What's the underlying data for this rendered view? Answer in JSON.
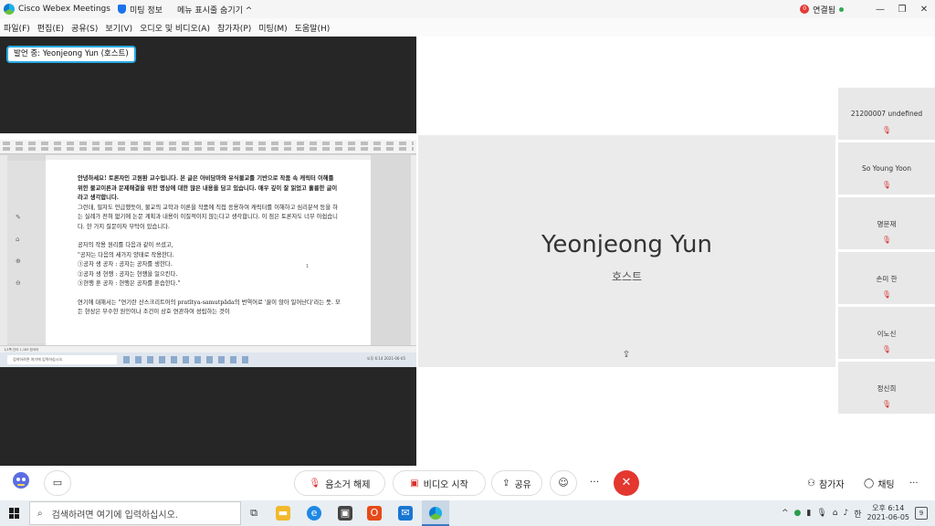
{
  "titlebar": {
    "app_name": "Cisco Webex Meetings",
    "meeting_info": "미팅 정보",
    "menu_toggle": "메뉴 표시줄 숨기기 ^",
    "connection_label": "연결됨",
    "connection_badge": "0",
    "minimize": "—",
    "restore": "❐",
    "close": "✕"
  },
  "menubar": {
    "items": [
      "파일(F)",
      "편집(E)",
      "공유(S)",
      "보기(V)",
      "오디오 및 비디오(A)",
      "참가자(P)",
      "미팅(M)",
      "도움말(H)"
    ]
  },
  "share": {
    "presenter_label": "발언 중: Yeonjeong Yun (호스트)"
  },
  "document": {
    "paragraphs": [
      "안녕하세요! 토론자인 고원환 교수입니다. 본 글은 아비담마와 유식불교를 기반으로 작품 속 캐릭터 이해를 위한 불교이론과 문제해결을 위한 명상에 대한 많은 내용을 담고 있습니다. 매우 깊이 잘 읽었고 훌륭한 글이라고 생각합니다.",
      "그런데, 필자도 언급했듯이, 불교의 교학과 이론을 작품에 직접 응용하여 캐릭터를 이해하고 심리분석 등을 하는 실례가 전혀 없기에 논문 계획과 내용이 이질적이지 않는다고 생각합니다. 이 점은 토론자도 너무 아쉽습니다. 한 가지 질문이자 부탁이 있습니다.",
      "공자의 작용 원리를 다음과 같이 쓰셨고,",
      "\"공자는 다음의 세가지 양태로 작용한다.",
      "①공자 생 공자 : 공자는 공자를 생한다.",
      "②공자 생 현행 : 공자는 현행을 일으킨다.",
      "③현행 훈 공자 : 현행은 공자를 훈습한다.\"",
      "연기에 대해서는 \"연기란 산스크리트어의 pratītya-samutpāda의 번역어로 '꿀이 앉아 일어난다'라는 뜻. 모든 현상은 무수한 원인이나 조건이 상호 연관하여 성립하는 것이"
    ],
    "page_number": "1",
    "status_text": "1/1쪽  단어 1,183  한국어",
    "taskbar_search": "검색하려면 여기에 입력하십시오.",
    "taskbar_clock": "오후 6:14 2021-06-05"
  },
  "speaker": {
    "name": "Yeonjeong Yun",
    "role": "호스트"
  },
  "participants": [
    {
      "name": "21200007 undefined"
    },
    {
      "name": "So Young Yoon"
    },
    {
      "name": "명문재"
    },
    {
      "name": "손미 한"
    },
    {
      "name": "이노신"
    },
    {
      "name": "정신희"
    }
  ],
  "controls": {
    "mute_label": "음소거 해제",
    "video_label": "비디오 시작",
    "share_label": "공유",
    "more": "···",
    "end": "✕",
    "participants_label": "참가자",
    "chat_label": "채팅",
    "right_more": "···"
  },
  "taskbar": {
    "search_placeholder": "검색하려면 여기에 입력하십시오.",
    "time": "오후 6:14",
    "date": "2021-06-05",
    "ime": "한",
    "notification_count": "9"
  },
  "colors": {
    "accent_blue": "#27a9e1",
    "end_red": "#e3372f",
    "mic_red": "#d9302f",
    "share_bg": "#262626"
  }
}
